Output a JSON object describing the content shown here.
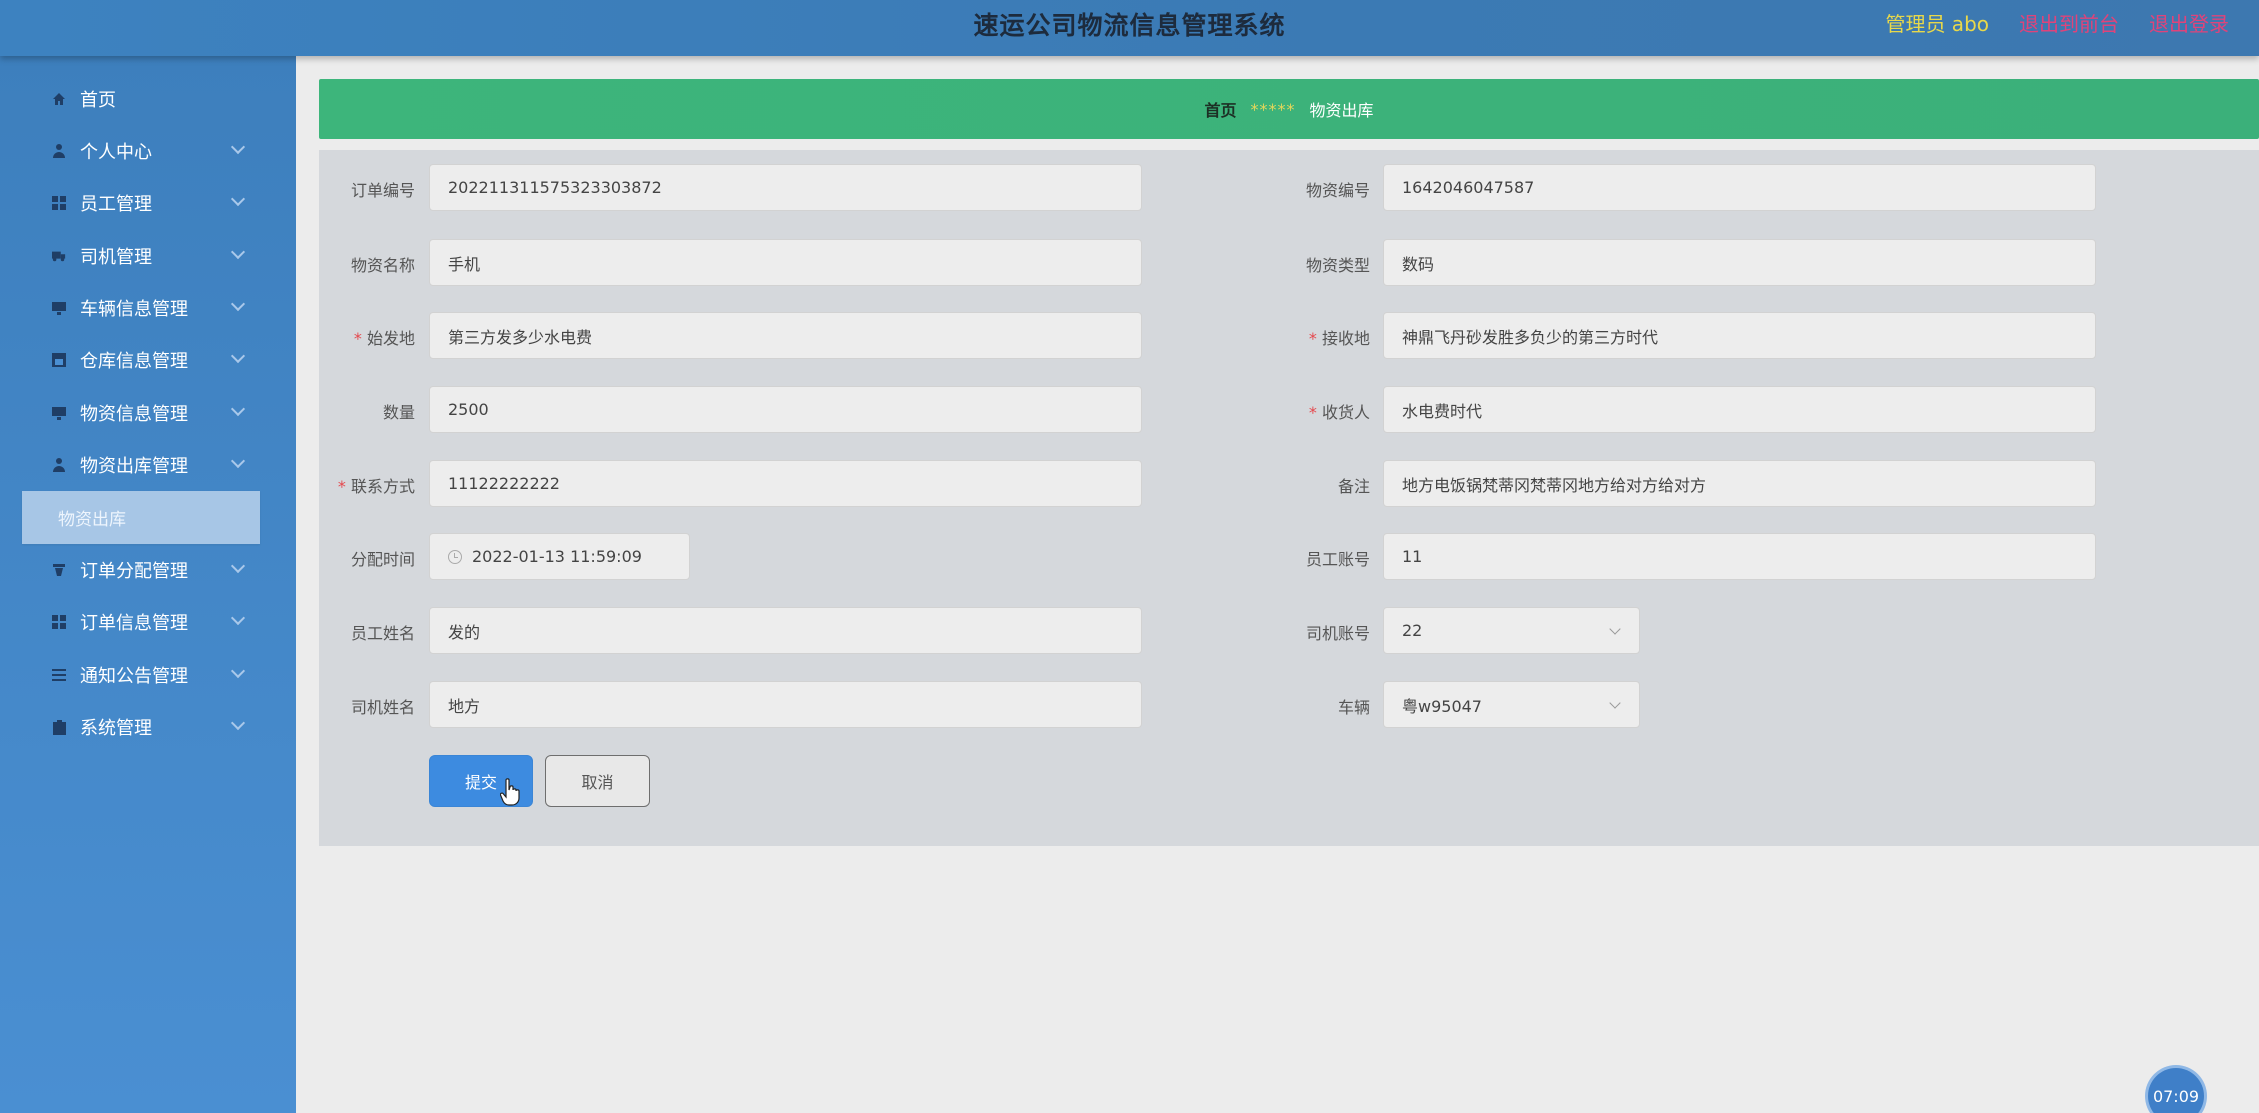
{
  "header": {
    "title": "速运公司物流信息管理系统",
    "user_label": "管理员 abo",
    "front_link": "退出到前台",
    "logout_link": "退出登录"
  },
  "sidebar": {
    "items": [
      {
        "label": "首页",
        "icon": "home-icon"
      },
      {
        "label": "个人中心",
        "icon": "person-icon"
      },
      {
        "label": "员工管理",
        "icon": "grid-icon"
      },
      {
        "label": "司机管理",
        "icon": "truck-icon"
      },
      {
        "label": "车辆信息管理",
        "icon": "monitor-icon"
      },
      {
        "label": "仓库信息管理",
        "icon": "warehouse-icon"
      },
      {
        "label": "物资信息管理",
        "icon": "monitor-icon"
      },
      {
        "label": "物资出库管理",
        "icon": "person-icon"
      },
      {
        "label": "订单分配管理",
        "icon": "cup-icon"
      },
      {
        "label": "订单信息管理",
        "icon": "grid-icon"
      },
      {
        "label": "通知公告管理",
        "icon": "list-icon"
      },
      {
        "label": "系统管理",
        "icon": "clipboard-icon"
      }
    ],
    "sub_active": "物资出库"
  },
  "breadcrumb": {
    "home": "首页",
    "separator": "*****",
    "current": "物资出库"
  },
  "form": {
    "order_no": {
      "label": "订单编号",
      "value": "202211311575323303872"
    },
    "material_no": {
      "label": "物资编号",
      "value": "1642046047587"
    },
    "material_name": {
      "label": "物资名称",
      "value": "手机"
    },
    "material_type": {
      "label": "物资类型",
      "value": "数码"
    },
    "origin": {
      "label": "始发地",
      "value": "第三方发多少水电费"
    },
    "destination": {
      "label": "接收地",
      "value": "神鼎飞丹砂发胜多负少的第三方时代"
    },
    "quantity": {
      "label": "数量",
      "value": "2500"
    },
    "receiver": {
      "label": "收货人",
      "value": "水电费时代"
    },
    "contact": {
      "label": "联系方式",
      "value": "11122222222"
    },
    "remark": {
      "label": "备注",
      "value": "地方电饭锅梵蒂冈梵蒂冈地方给对方给对方"
    },
    "assign_time": {
      "label": "分配时间",
      "value": "2022-01-13 11:59:09"
    },
    "staff_account": {
      "label": "员工账号",
      "value": "11"
    },
    "staff_name": {
      "label": "员工姓名",
      "value": "发的"
    },
    "driver_account": {
      "label": "司机账号",
      "value": "22"
    },
    "driver_name": {
      "label": "司机姓名",
      "value": "地方"
    },
    "vehicle": {
      "label": "车辆",
      "value": "粤w95047"
    },
    "submit_label": "提交",
    "cancel_label": "取消"
  },
  "clock": "07:09"
}
